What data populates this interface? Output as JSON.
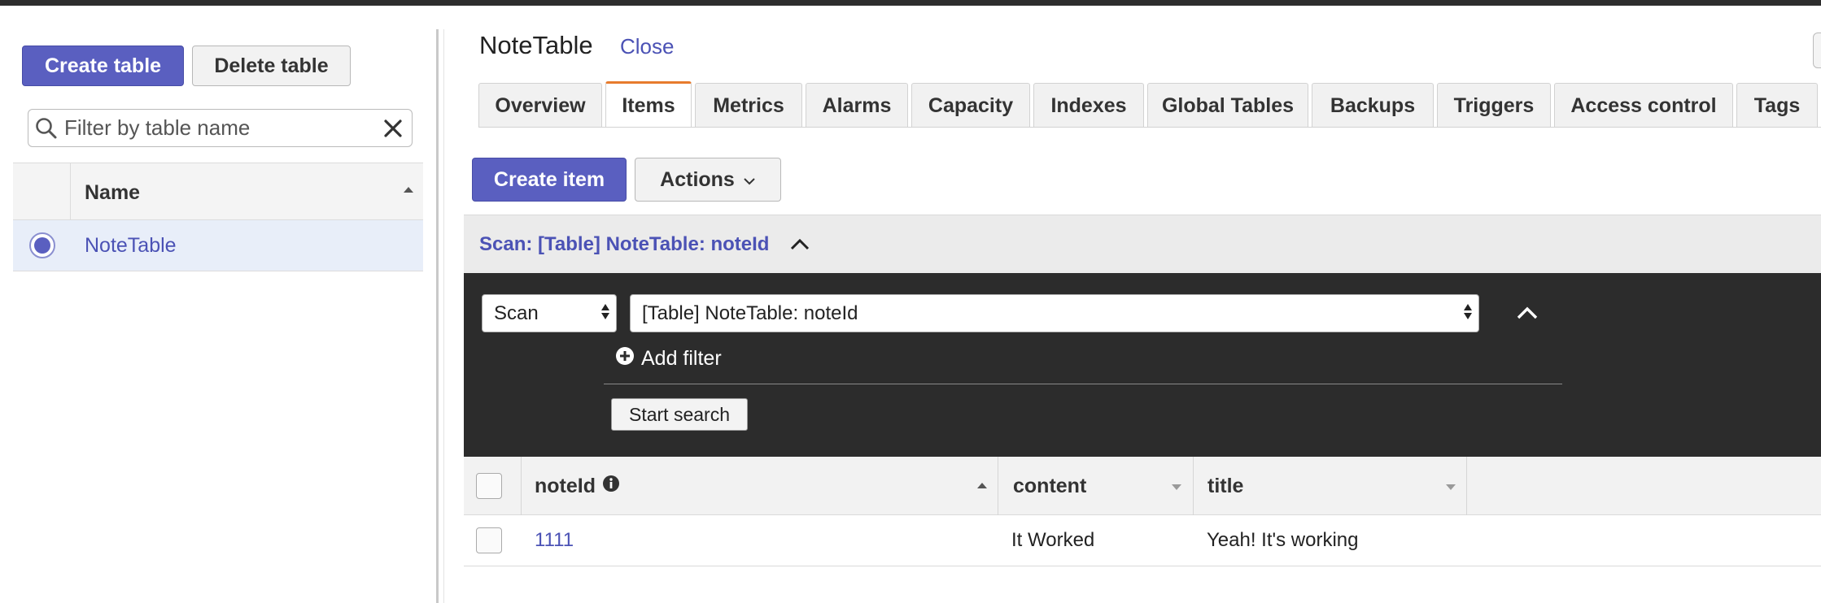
{
  "left_panel": {
    "create_table_label": "Create table",
    "delete_table_label": "Delete table",
    "filter_placeholder": "Filter by table name",
    "column_name_header": "Name",
    "tables": [
      {
        "name": "NoteTable",
        "selected": true
      }
    ]
  },
  "detail": {
    "table_title": "NoteTable",
    "close_label": "Close",
    "tabs": [
      {
        "label": "Overview"
      },
      {
        "label": "Items",
        "active": true
      },
      {
        "label": "Metrics"
      },
      {
        "label": "Alarms"
      },
      {
        "label": "Capacity"
      },
      {
        "label": "Indexes"
      },
      {
        "label": "Global Tables"
      },
      {
        "label": "Backups"
      },
      {
        "label": "Triggers"
      },
      {
        "label": "Access control"
      },
      {
        "label": "Tags"
      }
    ]
  },
  "items": {
    "create_item_label": "Create item",
    "actions_label": "Actions",
    "scan_summary": "Scan: [Table] NoteTable: noteId",
    "operation_value": "Scan",
    "target_value": "[Table] NoteTable: noteId",
    "add_filter_label": "Add filter",
    "start_search_label": "Start search",
    "columns": [
      {
        "label": "noteId"
      },
      {
        "label": "content"
      },
      {
        "label": "title"
      }
    ],
    "rows": [
      {
        "noteId": "1111",
        "content": "It Worked",
        "title": "Yeah! It's working"
      }
    ]
  },
  "colors": {
    "primary": "#5a5fc0",
    "link": "#4b52b5",
    "tab_active_accent": "#e77b2d",
    "query_panel_bg": "#2c2c2c"
  },
  "icons": [
    "search-icon",
    "clear-icon",
    "chevron-down-icon",
    "chevron-up-icon",
    "select-arrows-icon",
    "plus-circle-icon",
    "info-icon",
    "sort-asc-icon",
    "sort-desc-icon"
  ]
}
